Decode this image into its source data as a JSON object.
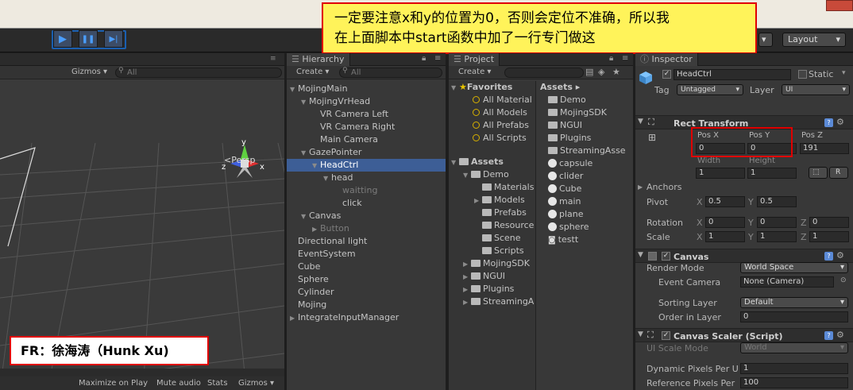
{
  "toolbar": {
    "play": "▶",
    "pause": "❚❚",
    "step": "▶|",
    "layers_arrow": "▾",
    "layout": "Layout"
  },
  "callout": {
    "text_line1": "一定要注意x和y的位置为0，否则会定位不准确，所以我",
    "text_line2": "在上面脚本中start函数中加了一行专门做这"
  },
  "scene": {
    "gizmos": "Gizmos ▾",
    "search_placeholder": "All",
    "persp": "<Persp",
    "axis_y": "y",
    "axis_x": "x",
    "axis_z": "z",
    "footer_items": [
      "Maximize on Play",
      "Mute audio",
      "Stats",
      "Gizmos ▾"
    ]
  },
  "credit": {
    "text": "FR：徐海涛（Hunk Xu)"
  },
  "hierarchy": {
    "tab": "Hierarchy",
    "create": "Create ▾",
    "search_placeholder": "All",
    "items": [
      {
        "label": "MojingMain",
        "indent": 0,
        "arrow": "▼"
      },
      {
        "label": "MojingVrHead",
        "indent": 1,
        "arrow": "▼"
      },
      {
        "label": "VR Camera Left",
        "indent": 2,
        "arrow": ""
      },
      {
        "label": "VR Camera Right",
        "indent": 2,
        "arrow": ""
      },
      {
        "label": "Main Camera",
        "indent": 2,
        "arrow": ""
      },
      {
        "label": "GazePointer",
        "indent": 1,
        "arrow": "▼"
      },
      {
        "label": "HeadCtrl",
        "indent": 2,
        "arrow": "▼",
        "selected": true
      },
      {
        "label": "head",
        "indent": 3,
        "arrow": "▼"
      },
      {
        "label": "waitting",
        "indent": 4,
        "arrow": "",
        "dim": true
      },
      {
        "label": "click",
        "indent": 4,
        "arrow": ""
      },
      {
        "label": "Canvas",
        "indent": 1,
        "arrow": "▼"
      },
      {
        "label": "Button",
        "indent": 2,
        "arrow": "▶",
        "dim": true
      },
      {
        "label": "Directional light",
        "indent": 0,
        "arrow": ""
      },
      {
        "label": "EventSystem",
        "indent": 0,
        "arrow": ""
      },
      {
        "label": "Cube",
        "indent": 0,
        "arrow": ""
      },
      {
        "label": "Sphere",
        "indent": 0,
        "arrow": ""
      },
      {
        "label": "Cylinder",
        "indent": 0,
        "arrow": ""
      },
      {
        "label": "Mojing",
        "indent": 0,
        "arrow": ""
      },
      {
        "label": "IntegrateInputManager",
        "indent": 0,
        "arrow": "▶"
      }
    ]
  },
  "project": {
    "tab": "Project",
    "create": "Create ▾",
    "favorites": {
      "title": "Favorites",
      "items": [
        "All Material",
        "All Models",
        "All Prefabs",
        "All Scripts"
      ]
    },
    "assets_tree": {
      "title": "Assets",
      "items": [
        {
          "label": "Demo",
          "indent": 1,
          "arrow": "▼"
        },
        {
          "label": "Materials",
          "indent": 2,
          "arrow": ""
        },
        {
          "label": "Models",
          "indent": 2,
          "arrow": "▶"
        },
        {
          "label": "Prefabs",
          "indent": 2,
          "arrow": ""
        },
        {
          "label": "Resource",
          "indent": 2,
          "arrow": ""
        },
        {
          "label": "Scene",
          "indent": 2,
          "arrow": ""
        },
        {
          "label": "Scripts",
          "indent": 2,
          "arrow": ""
        },
        {
          "label": "MojingSDK",
          "indent": 1,
          "arrow": "▶"
        },
        {
          "label": "NGUI",
          "indent": 1,
          "arrow": "▶"
        },
        {
          "label": "Plugins",
          "indent": 1,
          "arrow": "▶"
        },
        {
          "label": "StreamingA",
          "indent": 1,
          "arrow": "▶"
        }
      ]
    },
    "assets_header": "Assets ▸",
    "assets_list": [
      {
        "label": "Demo",
        "icon": "folder"
      },
      {
        "label": "MojingSDK",
        "icon": "folder"
      },
      {
        "label": "NGUI",
        "icon": "folder"
      },
      {
        "label": "Plugins",
        "icon": "folder"
      },
      {
        "label": "StreamingAsse",
        "icon": "folder"
      },
      {
        "label": "capsule",
        "icon": "unity"
      },
      {
        "label": "clider",
        "icon": "unity"
      },
      {
        "label": "Cube",
        "icon": "unity"
      },
      {
        "label": "main",
        "icon": "unity"
      },
      {
        "label": "plane",
        "icon": "unity"
      },
      {
        "label": "sphere",
        "icon": "unity"
      },
      {
        "label": "testt",
        "icon": "script"
      }
    ]
  },
  "inspector": {
    "tab": "Inspector",
    "name": "HeadCtrl",
    "static": "Static",
    "tag_label": "Tag",
    "tag_value": "Untagged",
    "layer_label": "Layer",
    "layer_value": "UI",
    "rect": {
      "title": "Rect Transform",
      "posx_label": "Pos X",
      "posy_label": "Pos Y",
      "posz_label": "Pos Z",
      "posx": "0",
      "posy": "0",
      "posz": "191",
      "width_label": "Width",
      "height_label": "Height",
      "width": "1",
      "height": "1",
      "r_btn": "R",
      "anchors": "Anchors",
      "pivot_label": "Pivot",
      "pivot_x": "0.5",
      "pivot_y": "0.5",
      "rotation_label": "Rotation",
      "rot_x": "0",
      "rot_y": "0",
      "rot_z": "0",
      "scale_label": "Scale",
      "scale_x": "1",
      "scale_y": "1",
      "scale_z": "1",
      "x": "X",
      "y": "Y",
      "z": "Z"
    },
    "canvas": {
      "title": "Canvas",
      "render_mode_label": "Render Mode",
      "render_mode": "World Space",
      "event_camera_label": "Event Camera",
      "event_camera": "None (Camera)",
      "sorting_layer_label": "Sorting Layer",
      "sorting_layer": "Default",
      "order_label": "Order in Layer",
      "order": "0"
    },
    "scaler": {
      "title": "Canvas Scaler (Script)",
      "ui_scale_label": "UI Scale Mode",
      "ui_scale": "World",
      "dyn_label": "Dynamic Pixels Per U",
      "dyn": "1",
      "ref_label": "Reference Pixels Per",
      "ref": "100"
    }
  }
}
